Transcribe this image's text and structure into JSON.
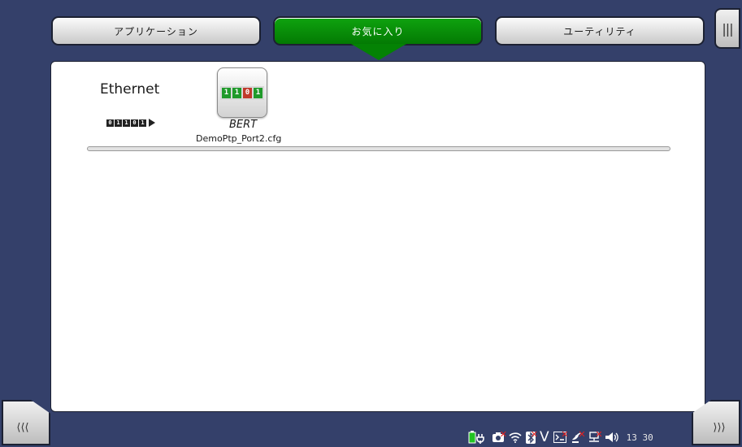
{
  "tabs": [
    {
      "label": "アプリケーション",
      "active": false
    },
    {
      "label": "お気に入り",
      "active": true
    },
    {
      "label": "ユーティリティ",
      "active": false
    }
  ],
  "menu_button": {
    "icon": "menu-icon",
    "glyph": "|||"
  },
  "nav": {
    "prev_glyph": "⟨⟨⟨",
    "next_glyph": "⟩⟩⟩"
  },
  "favorites": {
    "category": {
      "title": "Ethernet",
      "icon": "binary-stream-icon",
      "bits": [
        "0",
        "1",
        "1",
        "0",
        "1"
      ]
    },
    "items": [
      {
        "name": "BERT",
        "file": "DemoPtp_Port2.cfg",
        "icon": "bert-icon",
        "tile_bits": [
          "1",
          "1",
          "0",
          "1"
        ]
      }
    ]
  },
  "status_bar": {
    "icons": [
      "battery-plug-icon",
      "camera-icon",
      "wifi-icon",
      "bluetooth-icon",
      "v-icon",
      "terminal-icon",
      "satellite-icon",
      "network-icon",
      "speaker-icon"
    ],
    "time": "13 30"
  },
  "colors": {
    "background": "#34406a",
    "active_tab": "#048204",
    "panel": "#ffffff"
  }
}
